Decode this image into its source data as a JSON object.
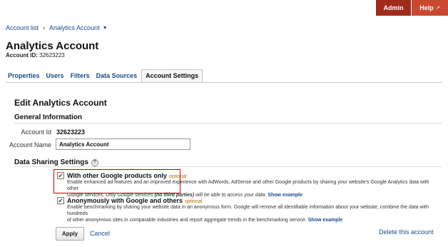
{
  "topbar": {
    "admin_label": "Admin",
    "help_label": "Help",
    "help_icon": "external-link-icon"
  },
  "breadcrumb": {
    "account_list": "Account list",
    "separator": "›",
    "current": "Analytics Account"
  },
  "header": {
    "title": "Analytics Account",
    "account_id_label": "Account ID:",
    "account_id_value": "32623223"
  },
  "tabs": [
    {
      "label": "Properties",
      "active": false
    },
    {
      "label": "Users",
      "active": false
    },
    {
      "label": "Filters",
      "active": false
    },
    {
      "label": "Data Sources",
      "active": false
    },
    {
      "label": "Account Settings",
      "active": true
    }
  ],
  "form": {
    "section_title": "Edit Analytics Account",
    "general_info_title": "General Information",
    "account_id_label": "Account Id",
    "account_id_value": "32623223",
    "account_name_label": "Account Name",
    "account_name_value": "Analytics Account"
  },
  "data_sharing": {
    "title": "Data Sharing Settings",
    "help_icon": "question-mark-icon",
    "options": [
      {
        "checked": true,
        "title": "With other Google products only",
        "optional": "optional",
        "desc_1": "Enable enhanced ad features and an improved experience with AdWords, AdSense and other Google products by sharing your website's Google Analytics data with other",
        "desc_2_prefix": "Google services. ",
        "desc_2_italic": "Only Google services ",
        "desc_2_bold_italic": "(no third parties)",
        "desc_2_italic_end": " will be able to access your data.",
        "show_example": "Show example"
      },
      {
        "checked": true,
        "title": "Anonymously with Google and others",
        "optional": "optional",
        "desc_1": "Enable benchmarking by sharing your website data in an anonymous form. Google will remove all identifiable information about your website, combine the data with hundreds",
        "desc_2": "of other anonymous sites in comparable industries and report aggregate trends in the benchmarking service.",
        "show_example": "Show example"
      }
    ]
  },
  "actions": {
    "apply": "Apply",
    "cancel": "Cancel",
    "delete": "Delete this account"
  },
  "colors": {
    "admin_bg": "#a02a1c",
    "help_bg": "#c8492f",
    "link": "#1a4c8a",
    "highlight": "#cc0000"
  }
}
